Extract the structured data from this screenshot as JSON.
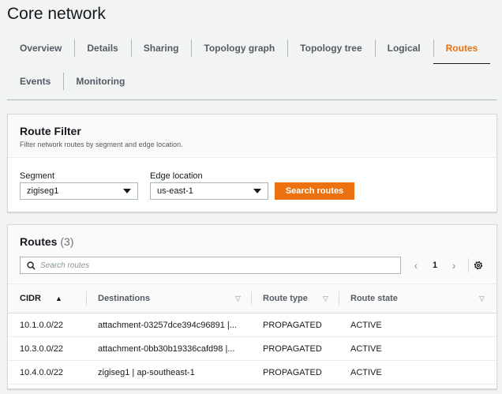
{
  "page": {
    "title": "Core network"
  },
  "tabs": [
    {
      "label": "Overview"
    },
    {
      "label": "Details"
    },
    {
      "label": "Sharing"
    },
    {
      "label": "Topology graph"
    },
    {
      "label": "Topology tree"
    },
    {
      "label": "Logical"
    },
    {
      "label": "Routes",
      "active": true
    },
    {
      "label": "Events"
    },
    {
      "label": "Monitoring"
    }
  ],
  "route_filter": {
    "title": "Route Filter",
    "description": "Filter network routes by segment and edge location.",
    "segment_label": "Segment",
    "segment_value": "zigiseg1",
    "edge_label": "Edge location",
    "edge_value": "us-east-1",
    "search_button": "Search routes"
  },
  "routes": {
    "title": "Routes",
    "count": "(3)",
    "search_placeholder": "Search routes",
    "page": "1",
    "columns": [
      "CIDR",
      "Destinations",
      "Route type",
      "Route state"
    ],
    "rows": [
      {
        "cidr": "10.1.0.0/22",
        "destination": "attachment-03257dce394c96891 |...",
        "type": "PROPAGATED",
        "state": "ACTIVE"
      },
      {
        "cidr": "10.3.0.0/22",
        "destination": "attachment-0bb30b19336cafd98 |...",
        "type": "PROPAGATED",
        "state": "ACTIVE"
      },
      {
        "cidr": "10.4.0.0/22",
        "destination": "zigiseg1 | ap-southeast-1",
        "type": "PROPAGATED",
        "state": "ACTIVE"
      }
    ]
  },
  "colors": {
    "accent": "#ec7211",
    "text": "#16191f",
    "muted": "#545b64",
    "background": "#f2f3f3"
  }
}
